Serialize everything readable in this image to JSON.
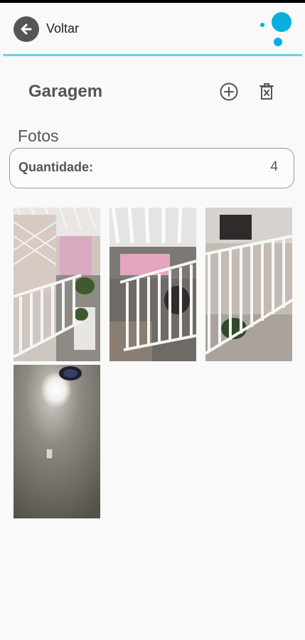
{
  "header": {
    "back_label": "Voltar",
    "back_icon": "arrow-left-icon",
    "logo_icon": "dots-logo-icon"
  },
  "section": {
    "title": "Garagem",
    "add_icon": "plus-circle-icon",
    "delete_icon": "trash-x-icon"
  },
  "photos": {
    "title": "Fotos",
    "quantity_label": "Quantidade:",
    "quantity_value": "4",
    "items": [
      {
        "id": "photo-1",
        "icon": "photo-thumbnail"
      },
      {
        "id": "photo-2",
        "icon": "photo-thumbnail"
      },
      {
        "id": "photo-3",
        "icon": "photo-thumbnail"
      },
      {
        "id": "photo-4",
        "icon": "photo-thumbnail"
      }
    ]
  },
  "colors": {
    "accent": "#72cbe8",
    "logo": "#0aaedf",
    "back_button": "#555555",
    "text": "#555555"
  }
}
